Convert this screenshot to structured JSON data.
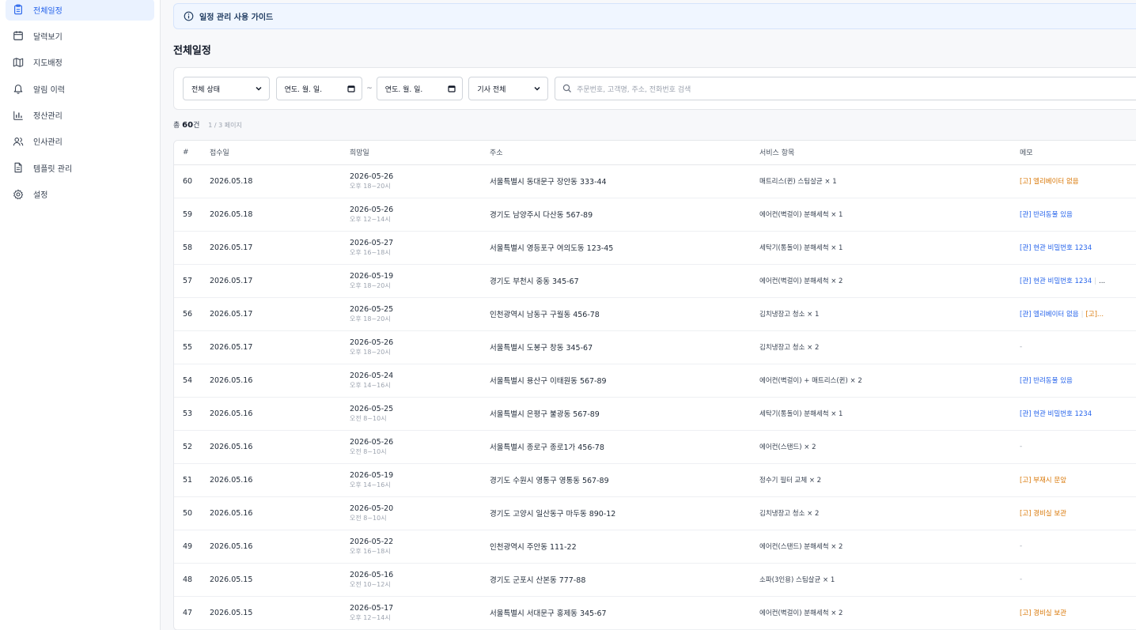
{
  "sidebar": {
    "items": [
      {
        "label": "전체일정",
        "icon": "clipboard-icon",
        "active": true
      },
      {
        "label": "달력보기",
        "icon": "calendar-icon",
        "active": false
      },
      {
        "label": "지도배정",
        "icon": "map-icon",
        "active": false
      },
      {
        "label": "알림 이력",
        "icon": "bell-icon",
        "active": false
      },
      {
        "label": "정산관리",
        "icon": "bar-chart-icon",
        "active": false
      },
      {
        "label": "인사관리",
        "icon": "users-icon",
        "active": false
      },
      {
        "label": "템플릿 관리",
        "icon": "document-icon",
        "active": false
      },
      {
        "label": "설정",
        "icon": "gear-icon",
        "active": false
      }
    ]
  },
  "guide": {
    "label": "일정 관리 사용 가이드"
  },
  "page": {
    "title": "전체일정"
  },
  "filters": {
    "status": "전체 상태",
    "date_from_placeholder": "연도. 월. 일.",
    "tilde": "~",
    "date_to_placeholder": "연도. 월. 일.",
    "driver": "기사 전체",
    "search_placeholder": "주문번호, 고객명, 주소, 전화번호 검색"
  },
  "summary": {
    "prefix": "총 ",
    "count": "60",
    "suffix": "건",
    "page_info": "1 / 3 페이지"
  },
  "table": {
    "headers": [
      "#",
      "접수일",
      "희망일",
      "주소",
      "서비스 항목",
      "메모"
    ],
    "rows": [
      {
        "no": "60",
        "received": "2026.05.18",
        "date": "2026-05-26",
        "time": "오후 18~20시",
        "address": "서울특별시 동대문구 장안동 333-44",
        "service": "매트리스(퀸) 스팀살균 × 1",
        "memo": [
          {
            "text": "[고] 엘리베이터 없음",
            "color": "orange"
          }
        ]
      },
      {
        "no": "59",
        "received": "2026.05.18",
        "date": "2026-05-26",
        "time": "오후 12~14시",
        "address": "경기도 남양주시 다산동 567-89",
        "service": "에어컨(벽걸이) 분해세척 × 1",
        "memo": [
          {
            "text": "[관] 반려동물 있음",
            "color": "blue"
          }
        ]
      },
      {
        "no": "58",
        "received": "2026.05.17",
        "date": "2026-05-27",
        "time": "오후 16~18시",
        "address": "서울특별시 영등포구 여의도동 123-45",
        "service": "세탁기(통돌이) 분해세척 × 1",
        "memo": [
          {
            "text": "[관] 현관 비밀번호 1234",
            "color": "blue"
          }
        ]
      },
      {
        "no": "57",
        "received": "2026.05.17",
        "date": "2026-05-19",
        "time": "오후 18~20시",
        "address": "경기도 부천시 중동 345-67",
        "service": "에어컨(벽걸이) 분해세척 × 2",
        "memo": [
          {
            "text": "[관] 현관 비밀번호 1234",
            "color": "blue"
          },
          {
            "text": "...",
            "color": "dark"
          }
        ]
      },
      {
        "no": "56",
        "received": "2026.05.17",
        "date": "2026-05-25",
        "time": "오후 18~20시",
        "address": "인천광역시 남동구 구월동 456-78",
        "service": "김치냉장고 청소 × 1",
        "memo": [
          {
            "text": "[관] 엘리베이터 없음",
            "color": "blue"
          },
          {
            "text": "[고]...",
            "color": "orange"
          }
        ]
      },
      {
        "no": "55",
        "received": "2026.05.17",
        "date": "2026-05-26",
        "time": "오후 18~20시",
        "address": "서울특별시 도봉구 창동 345-67",
        "service": "김치냉장고 청소 × 2",
        "memo": [
          {
            "text": "-",
            "color": "dash"
          }
        ]
      },
      {
        "no": "54",
        "received": "2026.05.16",
        "date": "2026-05-24",
        "time": "오후 14~16시",
        "address": "서울특별시 용산구 이태원동 567-89",
        "service": "에어컨(벽걸이) + 매트리스(퀸) × 2",
        "memo": [
          {
            "text": "[관] 반려동물 있음",
            "color": "blue"
          }
        ]
      },
      {
        "no": "53",
        "received": "2026.05.16",
        "date": "2026-05-25",
        "time": "오전 8~10시",
        "address": "서울특별시 은평구 불광동 567-89",
        "service": "세탁기(통돌이) 분해세척 × 1",
        "memo": [
          {
            "text": "[관] 현관 비밀번호 1234",
            "color": "blue"
          }
        ]
      },
      {
        "no": "52",
        "received": "2026.05.16",
        "date": "2026-05-26",
        "time": "오전 8~10시",
        "address": "서울특별시 종로구 종로1가 456-78",
        "service": "에어컨(스탠드) × 2",
        "memo": [
          {
            "text": "-",
            "color": "dash"
          }
        ]
      },
      {
        "no": "51",
        "received": "2026.05.16",
        "date": "2026-05-19",
        "time": "오후 14~16시",
        "address": "경기도 수원시 영통구 영통동 567-89",
        "service": "정수기 필터 교체 × 2",
        "memo": [
          {
            "text": "[고] 부재시 문앞",
            "color": "orange"
          }
        ]
      },
      {
        "no": "50",
        "received": "2026.05.16",
        "date": "2026-05-20",
        "time": "오전 8~10시",
        "address": "경기도 고양시 일산동구 마두동 890-12",
        "service": "김치냉장고 청소 × 2",
        "memo": [
          {
            "text": "[고] 경비실 보관",
            "color": "orange"
          }
        ]
      },
      {
        "no": "49",
        "received": "2026.05.16",
        "date": "2026-05-22",
        "time": "오후 16~18시",
        "address": "인천광역시 주안동 111-22",
        "service": "에어컨(스탠드) 분해세척 × 2",
        "memo": [
          {
            "text": "-",
            "color": "dash"
          }
        ]
      },
      {
        "no": "48",
        "received": "2026.05.15",
        "date": "2026-05-16",
        "time": "오전 10~12시",
        "address": "경기도 군포시 산본동 777-88",
        "service": "소파(3인용) 스팀살균 × 1",
        "memo": [
          {
            "text": "-",
            "color": "dash"
          }
        ]
      },
      {
        "no": "47",
        "received": "2026.05.15",
        "date": "2026-05-17",
        "time": "오후 12~14시",
        "address": "서울특별시 서대문구 홍제동 345-67",
        "service": "에어컨(벽걸이) 분해세척 × 2",
        "memo": [
          {
            "text": "[고] 경비실 보관",
            "color": "orange"
          }
        ]
      }
    ]
  },
  "colors": {
    "accent": "#2563eb",
    "orange": "#d97706"
  }
}
